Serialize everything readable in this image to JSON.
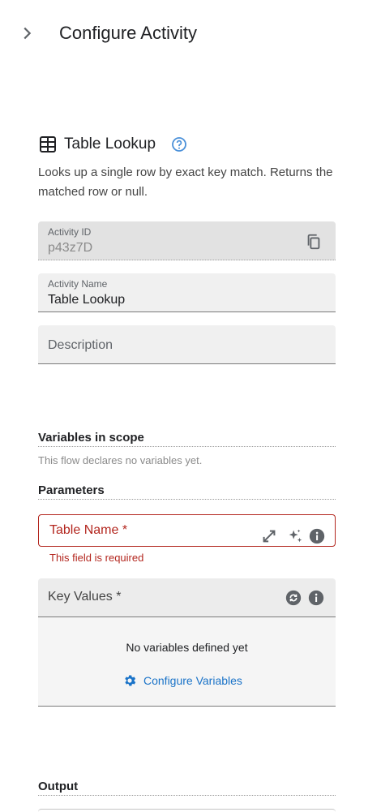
{
  "header": {
    "title": "Configure Activity"
  },
  "activity": {
    "title": "Table Lookup",
    "description": "Looks up a single row by exact key match. Returns the matched row or null."
  },
  "fields": {
    "activity_id": {
      "label": "Activity ID",
      "value": "p43z7D"
    },
    "activity_name": {
      "label": "Activity Name",
      "value": "Table Lookup"
    },
    "description": {
      "placeholder": "Description"
    }
  },
  "variables": {
    "title": "Variables in scope",
    "empty_text": "This flow declares no variables yet."
  },
  "parameters": {
    "title": "Parameters",
    "table_name": {
      "label": "Table Name *",
      "error": "This field is required"
    },
    "key_values": {
      "label": "Key Values *",
      "empty_text": "No variables defined yet",
      "configure_label": "Configure Variables"
    }
  },
  "output": {
    "title": "Output"
  },
  "colors": {
    "error": "#b3261e",
    "link": "#1a73c8",
    "help": "#4a90d9"
  }
}
